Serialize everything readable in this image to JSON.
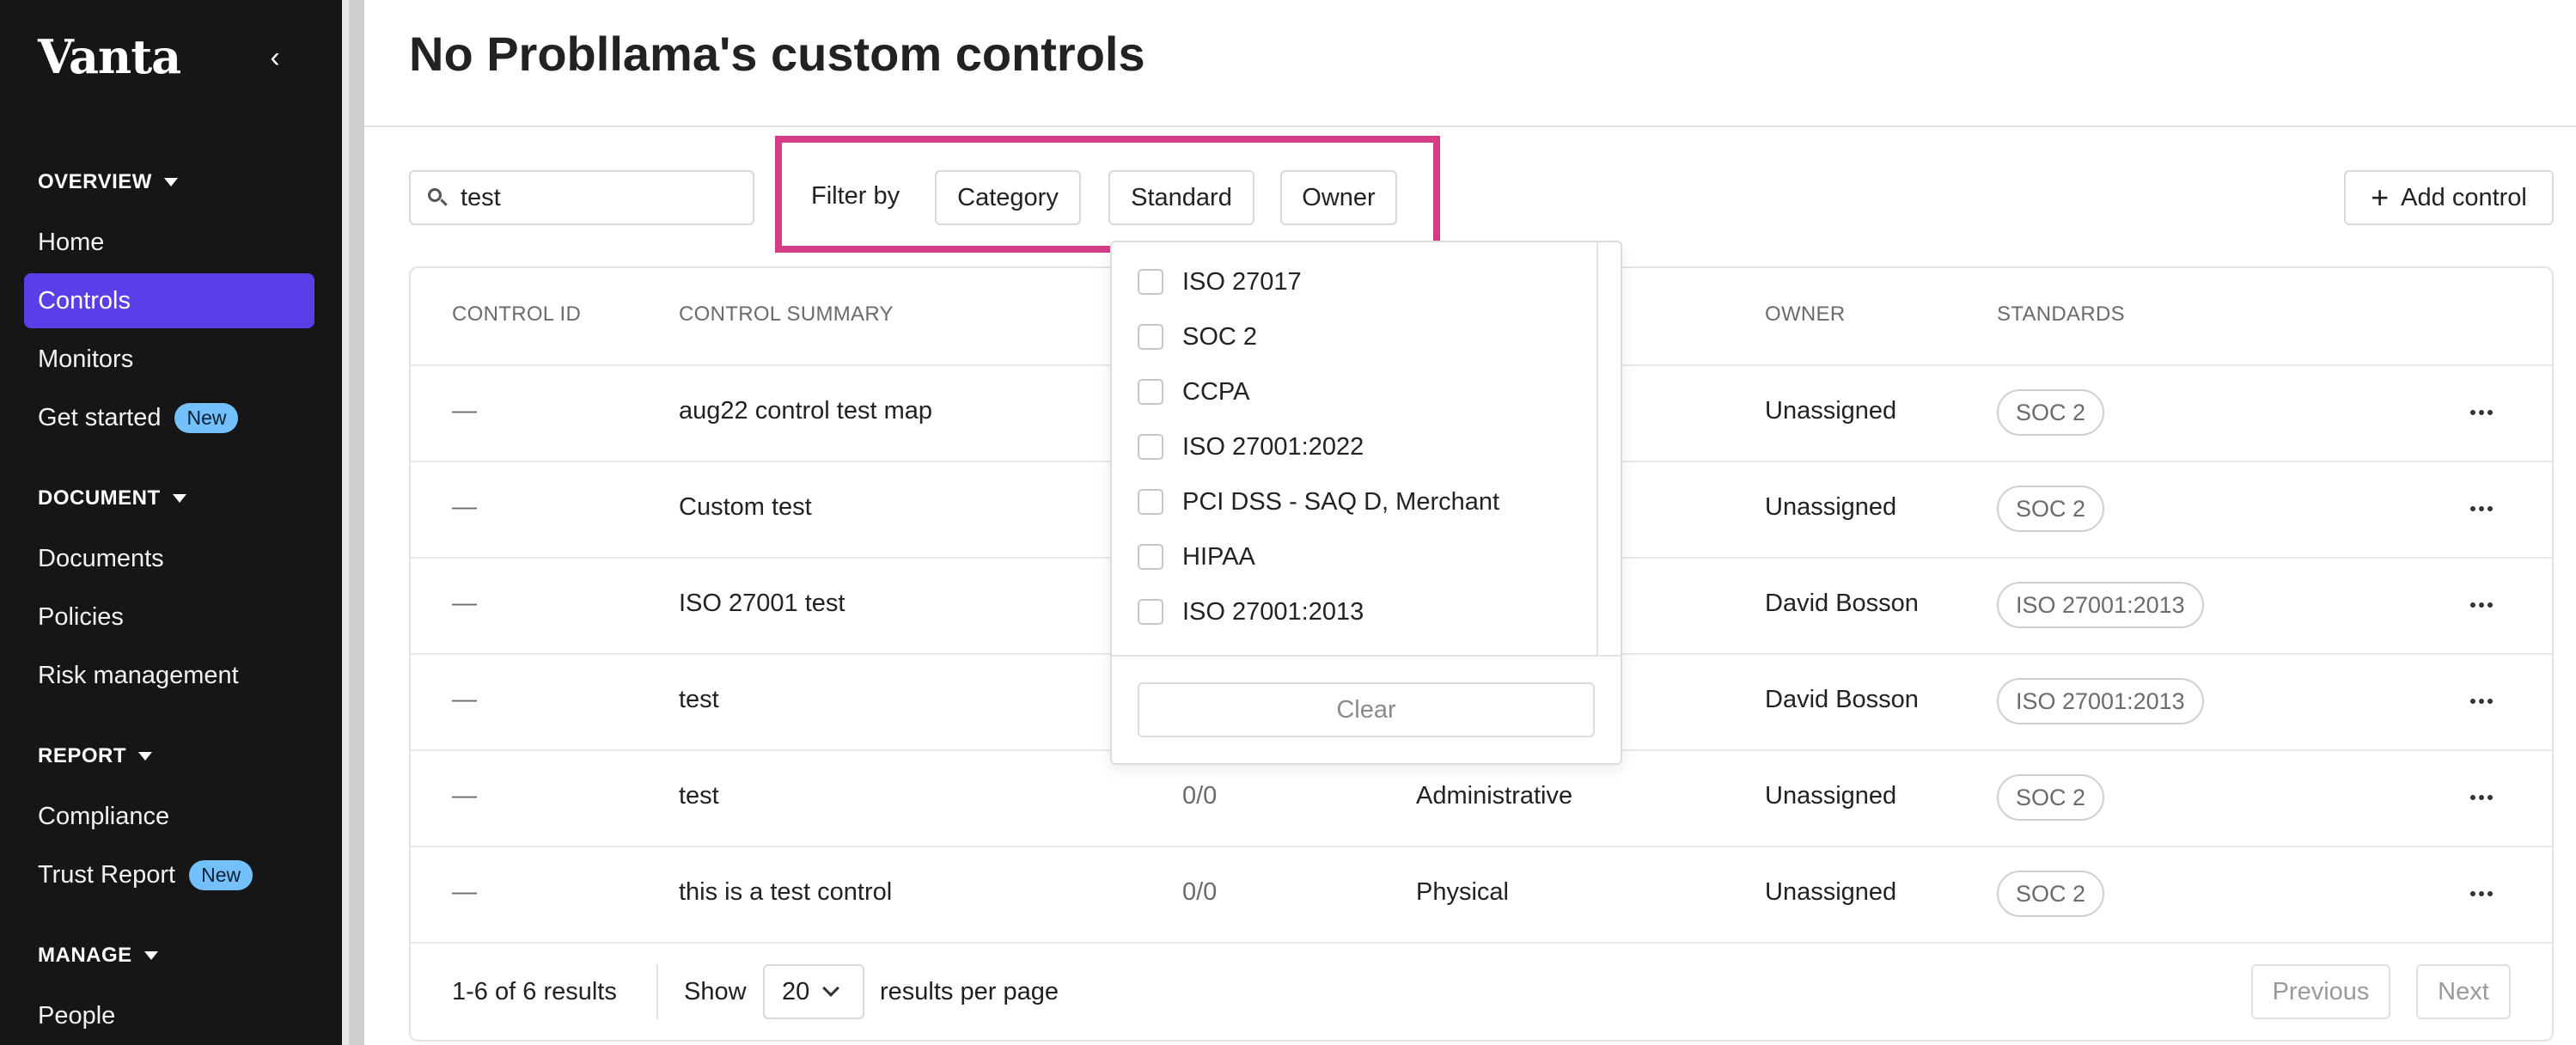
{
  "sidebar": {
    "logo": "Vanta",
    "sections": [
      {
        "heading": "OVERVIEW",
        "items": [
          {
            "label": "Home"
          },
          {
            "label": "Controls",
            "active": true
          },
          {
            "label": "Monitors"
          },
          {
            "label": "Get started",
            "badge": "New"
          }
        ]
      },
      {
        "heading": "DOCUMENT",
        "items": [
          {
            "label": "Documents"
          },
          {
            "label": "Policies"
          },
          {
            "label": "Risk management"
          }
        ]
      },
      {
        "heading": "REPORT",
        "items": [
          {
            "label": "Compliance"
          },
          {
            "label": "Trust Report",
            "badge": "New"
          }
        ]
      },
      {
        "heading": "MANAGE",
        "items": [
          {
            "label": "People"
          }
        ]
      }
    ]
  },
  "header": {
    "title": "No Probllama's custom controls"
  },
  "toolbar": {
    "search_value": "test",
    "filter_label": "Filter by",
    "filters": [
      "Category",
      "Standard",
      "Owner"
    ],
    "add_label": "Add control"
  },
  "table": {
    "headers": [
      "CONTROL ID",
      "CONTROL SUMMARY",
      "OWNER",
      "STANDARDS"
    ],
    "rows": [
      {
        "id": "—",
        "summary": "aug22 control test map",
        "tests": "",
        "category": "",
        "owner": "Unassigned",
        "standard": "SOC 2"
      },
      {
        "id": "—",
        "summary": "Custom test",
        "tests": "",
        "category": "",
        "owner": "Unassigned",
        "standard": "SOC 2"
      },
      {
        "id": "—",
        "summary": "ISO 27001 test",
        "tests": "",
        "category": "",
        "owner": "David Bosson",
        "standard": "ISO 27001:2013"
      },
      {
        "id": "—",
        "summary": "test",
        "tests": "",
        "category": "",
        "owner": "David Bosson",
        "standard": "ISO 27001:2013"
      },
      {
        "id": "—",
        "summary": "test",
        "tests": "0/0",
        "category": "Administrative",
        "owner": "Unassigned",
        "standard": "SOC 2"
      },
      {
        "id": "—",
        "summary": "this is a test control",
        "tests": "0/0",
        "category": "Physical",
        "owner": "Unassigned",
        "standard": "SOC 2"
      }
    ]
  },
  "footer": {
    "range": "1-6",
    "of": "of",
    "total": "6",
    "results_word": "results",
    "show_label": "Show",
    "per_page": "20",
    "per_page_label": "results per page",
    "previous": "Previous",
    "next": "Next"
  },
  "dropdown": {
    "options": [
      "ISO 27017",
      "SOC 2",
      "CCPA",
      "ISO 27001:2022",
      "PCI DSS - SAQ D, Merchant",
      "HIPAA",
      "ISO 27001:2013"
    ],
    "clear_label": "Clear"
  },
  "colors": {
    "active_nav": "#5b3ee8",
    "highlight": "#d63d86",
    "badge": "#74c0fc"
  }
}
